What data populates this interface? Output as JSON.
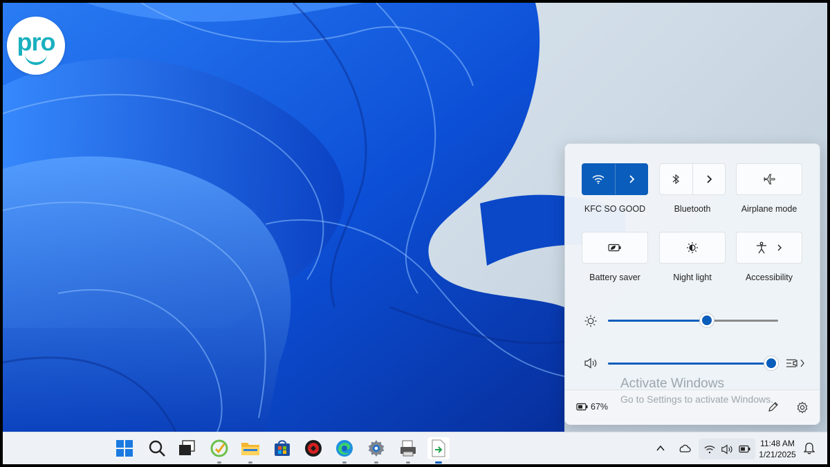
{
  "logo": {
    "text": "pro"
  },
  "quick_settings": {
    "tiles_row1": [
      {
        "label": "KFC SO GOOD",
        "icon": "wifi-icon",
        "active": true
      },
      {
        "label": "Bluetooth",
        "icon": "bluetooth-icon",
        "active": false
      },
      {
        "label": "Airplane mode",
        "icon": "airplane-icon",
        "active": false
      }
    ],
    "tiles_row2": [
      {
        "label": "Battery saver",
        "icon": "battery-saver-icon",
        "active": false
      },
      {
        "label": "Night light",
        "icon": "night-light-icon",
        "active": false
      },
      {
        "label": "Accessibility",
        "icon": "accessibility-icon",
        "active": false
      }
    ],
    "brightness": {
      "level": 0.58,
      "icon": "brightness-icon"
    },
    "volume": {
      "level": 1.0,
      "icon": "speaker-icon"
    },
    "footer": {
      "battery_percent": "67%",
      "edit_icon": "pencil-icon",
      "settings_icon": "gear-icon"
    }
  },
  "watermark": {
    "line1": "Activate Windows",
    "line2": "Go to Settings to activate Windows."
  },
  "taskbar": {
    "apps": [
      "start-icon",
      "search-icon",
      "task-view-icon",
      "app-green-icon",
      "file-explorer-icon",
      "store-icon",
      "app-red-icon",
      "edge-icon",
      "settings-icon",
      "app-printer-icon",
      "app-export-icon"
    ],
    "tray": {
      "time": "11:48 AM",
      "date": "1/21/2025"
    }
  },
  "colors": {
    "accent": "#0a5dbb",
    "wallpaper": "#1565e8",
    "logo": "#1ab0bf"
  }
}
